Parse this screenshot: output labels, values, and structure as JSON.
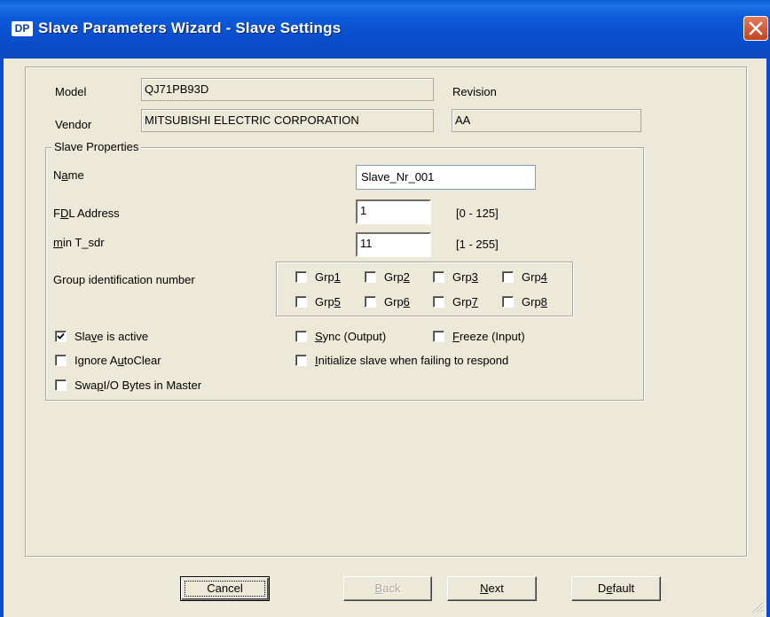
{
  "window": {
    "title": "Slave Parameters Wizard - Slave Settings",
    "app_icon_text": "DP",
    "close_icon": "close-icon",
    "accent": "#0b4bd0",
    "close_color": "#c6431f"
  },
  "header": {
    "model_label": "Model",
    "model_value": "QJ71PB93D",
    "vendor_label": "Vendor",
    "vendor_value": "MITSUBISHI ELECTRIC CORPORATION",
    "revision_label": "Revision",
    "revision_value": "AA"
  },
  "slave_properties": {
    "legend": "Slave Properties",
    "name_label_pre": "N",
    "name_label_u": "a",
    "name_label_post": "me",
    "name_value": "Slave_Nr_001",
    "fdl_label_pre": "F",
    "fdl_label_u": "D",
    "fdl_label_post": "L Address",
    "fdl_value": "1",
    "fdl_range": "[0 - 125]",
    "tsdr_label_pre": "",
    "tsdr_label_u": "m",
    "tsdr_label_post": "in T_sdr",
    "tsdr_value": "11",
    "tsdr_range": "[1 - 255]",
    "group_label": "Group identification number",
    "groups": [
      {
        "pre": "Grp ",
        "u": "1",
        "checked": false
      },
      {
        "pre": "Grp ",
        "u": "2",
        "checked": false
      },
      {
        "pre": "Grp ",
        "u": "3",
        "checked": false
      },
      {
        "pre": "Grp ",
        "u": "4",
        "checked": false
      },
      {
        "pre": "Grp ",
        "u": "5",
        "checked": false
      },
      {
        "pre": "Grp ",
        "u": "6",
        "checked": false
      },
      {
        "pre": "Grp ",
        "u": "7",
        "checked": false
      },
      {
        "pre": "Grp ",
        "u": "8",
        "checked": false
      }
    ],
    "options": {
      "slave_active": {
        "pre": "Sla",
        "u": "v",
        "post": "e is active",
        "checked": true
      },
      "ignore_autoclear": {
        "pre": "Ignore A",
        "u": "u",
        "post": "toClear",
        "checked": false
      },
      "swap_io": {
        "pre": "Swa",
        "u": "p",
        "post": " I/O Bytes in Master",
        "checked": false
      },
      "sync_output": {
        "pre": "",
        "u": "S",
        "post": "ync (Output)",
        "checked": false
      },
      "freeze_input": {
        "pre": "",
        "u": "F",
        "post": "reeze (Input)",
        "checked": false
      },
      "init_slave": {
        "pre": "",
        "u": "I",
        "post": "nitialize slave when failing to respond",
        "checked": false
      }
    }
  },
  "buttons": {
    "cancel": "Cancel",
    "back_u": "B",
    "back_post": "ack",
    "next_u": "N",
    "next_post": "ext",
    "default_pre": "D",
    "default_u": "e",
    "default_post": "fault"
  }
}
